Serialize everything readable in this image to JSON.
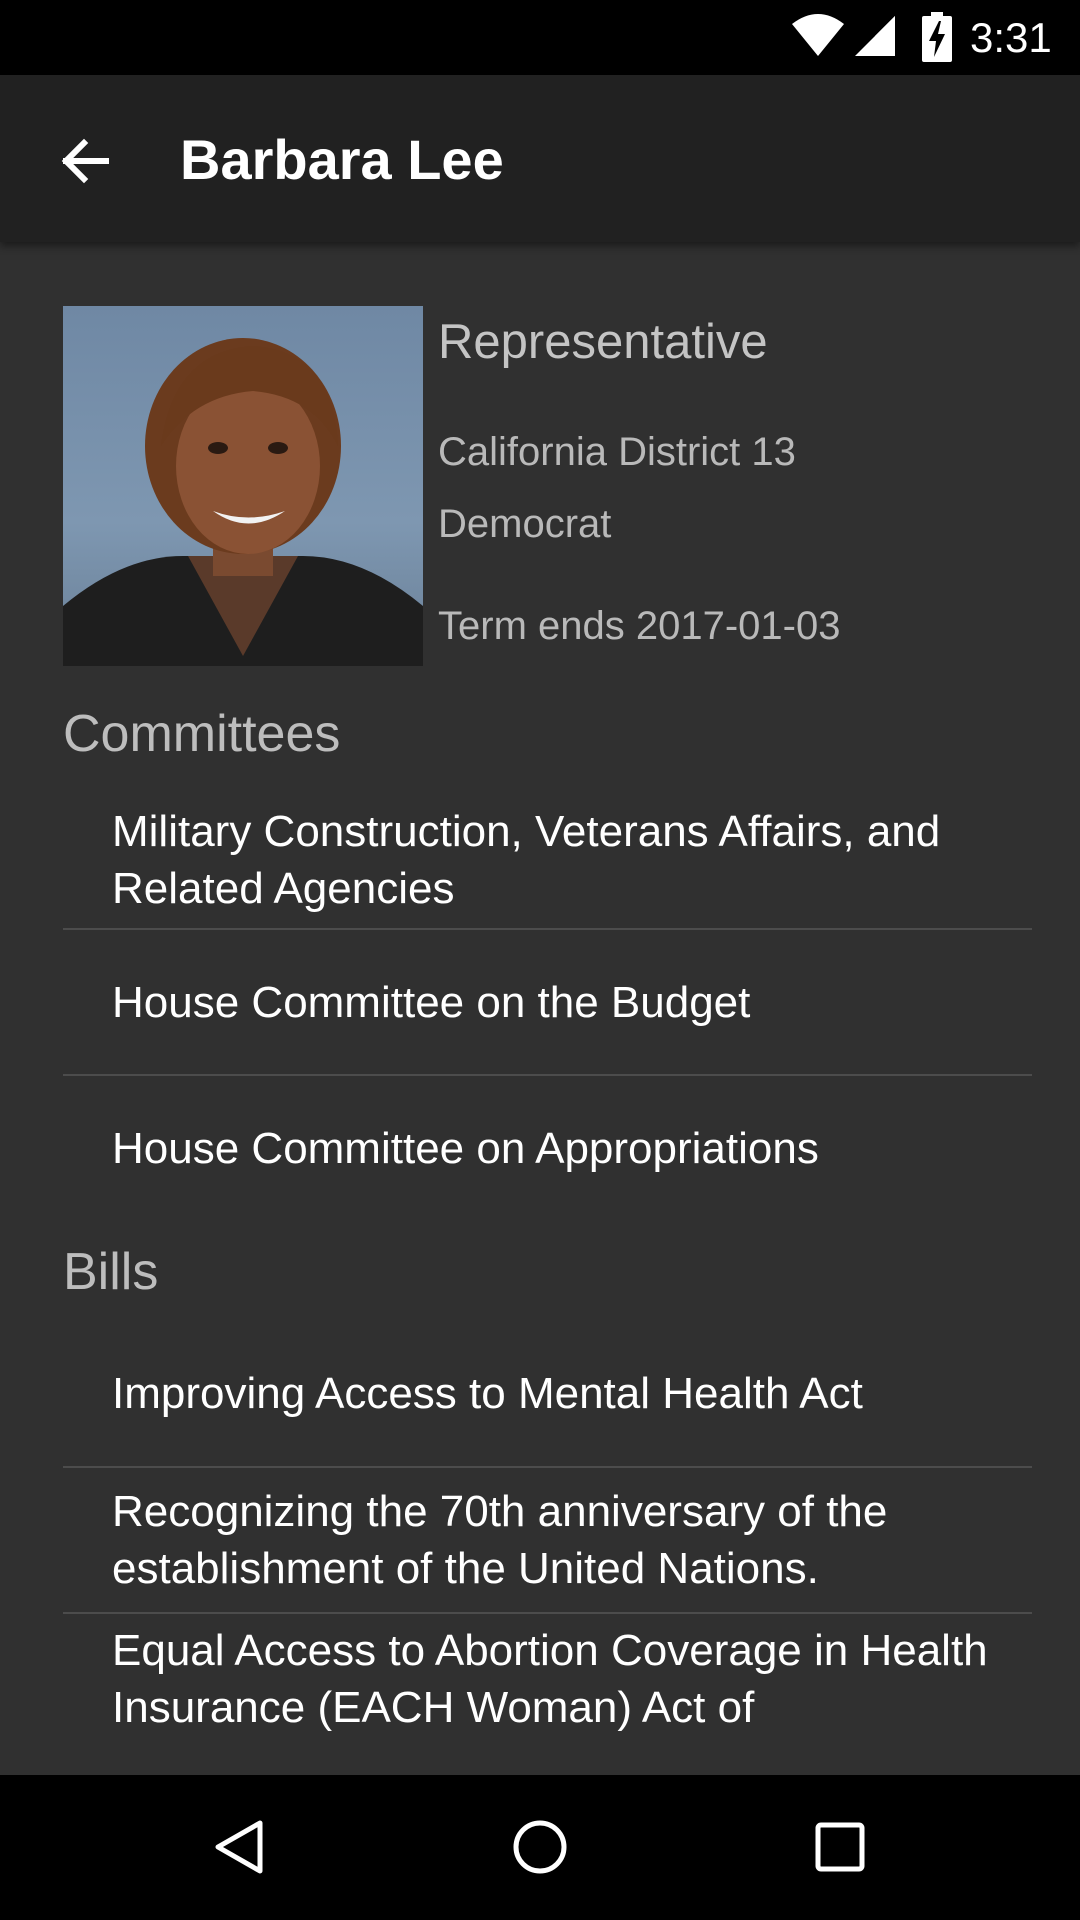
{
  "status_bar": {
    "time": "3:31",
    "icons": [
      "wifi-icon",
      "cell-signal-icon",
      "battery-charging-icon"
    ]
  },
  "app_bar": {
    "back_icon": "arrow-back-icon",
    "title": "Barbara Lee"
  },
  "profile": {
    "photo": "member-portrait",
    "chamber": "Representative",
    "district": "California District 13",
    "party": "Democrat",
    "term": "Term ends 2017-01-03"
  },
  "committees": {
    "title": "Committees",
    "items": [
      "Military Construction, Veterans Affairs, and Related Agencies",
      "House Committee on the Budget",
      "House Committee on Appropriations"
    ]
  },
  "bills": {
    "title": "Bills",
    "items": [
      "Improving Access to Mental Health Act",
      "Recognizing the 70th anniversary of the establishment of the United Nations.",
      "Equal Access to Abortion Coverage in Health Insurance (EACH Woman) Act of"
    ]
  },
  "nav_bar": {
    "buttons": [
      "back-triangle-icon",
      "home-circle-icon",
      "recents-square-icon"
    ]
  },
  "colors": {
    "background": "#303030",
    "app_bar": "#212121",
    "system_bars": "#000000",
    "secondary_text": "#bdbdbd",
    "divider": "#4c4c4c"
  }
}
